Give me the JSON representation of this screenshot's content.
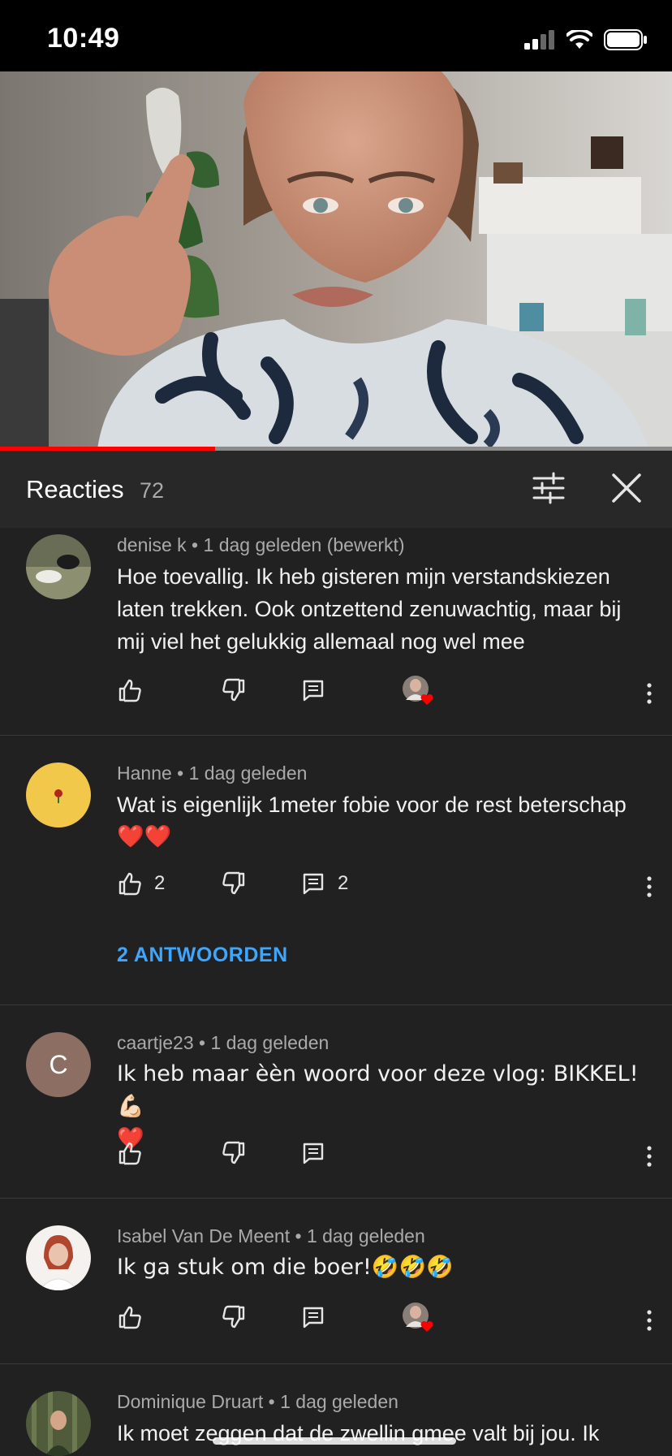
{
  "status_bar": {
    "time": "10:49"
  },
  "video": {
    "progress_fraction": 0.32
  },
  "comments_header": {
    "title": "Reacties",
    "count": "72"
  },
  "comments": [
    {
      "author": "denise k",
      "time": "1 dag geleden (bewerkt)",
      "lines": [
        "Hoe toevallig. Ik heb gisteren mijn verstandskiezen",
        "laten trekken. Ook ontzettend zenuwachtig, maar bij",
        "mij viel het gelukkig allemaal nog wel mee"
      ],
      "likes": "",
      "replies_count": "",
      "creator_heart": true,
      "replies_link": ""
    },
    {
      "author": "Hanne",
      "time": "1 dag geleden",
      "lines": [
        "Wat is eigenlijk 1meter fobie voor de rest beterschap",
        "❤️❤️"
      ],
      "likes": "2",
      "replies_count": "2",
      "creator_heart": false,
      "replies_link": "2 ANTWOORDEN"
    },
    {
      "author": "caartje23",
      "time": "1 dag geleden",
      "avatar_letter": "C",
      "lines": [
        "Ik heb maar èèn woord voor deze vlog: BIKKEL! 💪🏻",
        "❤️"
      ],
      "likes": "",
      "replies_count": "",
      "creator_heart": false,
      "replies_link": ""
    },
    {
      "author": "Isabel Van De Meent",
      "time": "1 dag geleden",
      "lines": [
        "Ik ga stuk om die boer!🤣🤣🤣"
      ],
      "likes": "",
      "replies_count": "",
      "creator_heart": true,
      "replies_link": ""
    },
    {
      "author": "Dominique Druart",
      "time": "1 dag geleden",
      "lines": [
        "Ik moet zeggen dat de zwellin gmee valt bij jou. Ik"
      ],
      "likes": "",
      "replies_count": "",
      "creator_heart": false,
      "replies_link": ""
    }
  ],
  "icons": {
    "like": "thumbs-up-icon",
    "dislike": "thumbs-down-icon",
    "reply": "comment-icon",
    "more": "more-vert-icon",
    "filter": "sort-filter-icon",
    "close": "close-icon",
    "creator_heart": "creator-heart-icon"
  },
  "colors": {
    "background": "#212121",
    "header": "#282828",
    "link": "#3ea6ff",
    "progress": "#ff0000",
    "meta_text": "#aaaaaa"
  }
}
